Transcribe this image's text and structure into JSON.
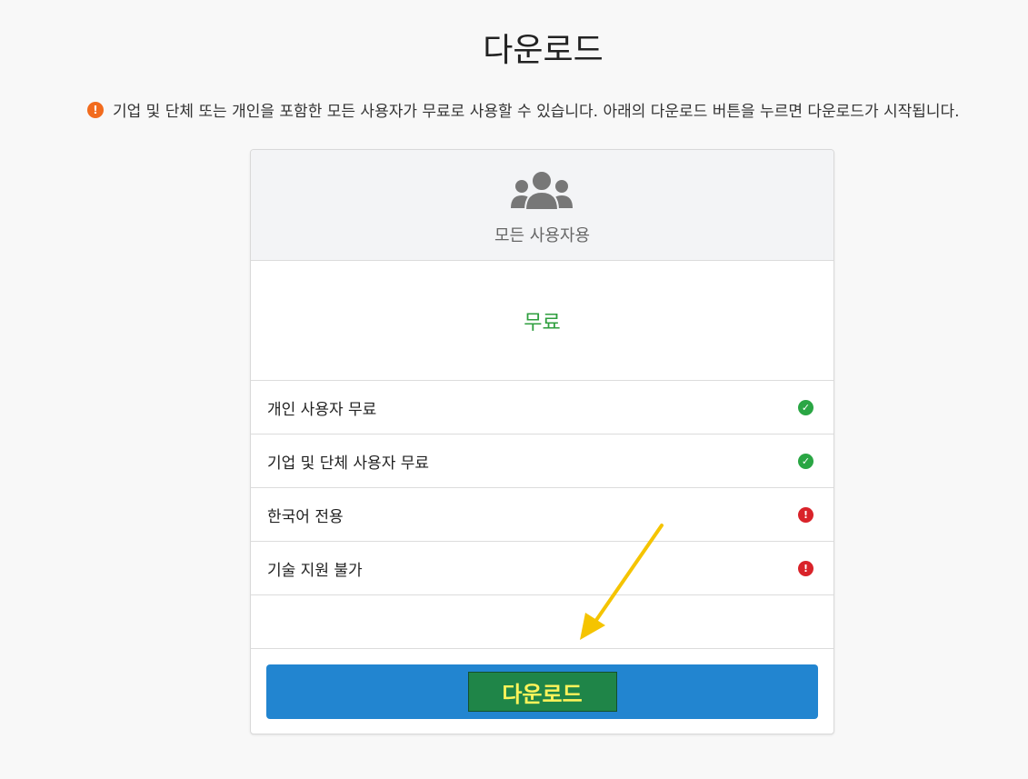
{
  "page": {
    "title": "다운로드",
    "notice": "기업 및 단체 또는 개인을 포함한 모든 사용자가 무료로 사용할 수 있습니다. 아래의 다운로드 버튼을 누르면 다운로드가 시작됩니다."
  },
  "plan": {
    "icon": "users-icon",
    "subtitle": "모든 사용자용",
    "price": "무료",
    "features": [
      {
        "label": "개인 사용자 무료",
        "status": "check"
      },
      {
        "label": "기업 및 단체 사용자 무료",
        "status": "check"
      },
      {
        "label": "한국어 전용",
        "status": "alert"
      },
      {
        "label": "기술 지원 불가",
        "status": "alert"
      }
    ],
    "download_label": "다운로드"
  },
  "colors": {
    "notice_icon": "#f26b1d",
    "price_text": "#2e9e3e",
    "check": "#2aa644",
    "alert": "#d9232a",
    "button_bar": "#2285d0",
    "button_inner": "#1f8548",
    "button_text": "#fff45a",
    "arrow": "#f5c400"
  }
}
